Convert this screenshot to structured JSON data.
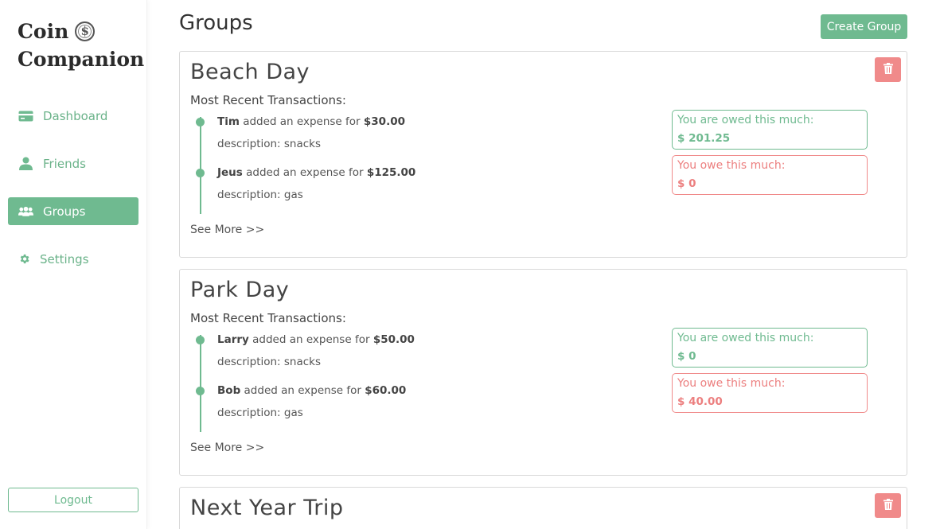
{
  "app": {
    "logo_line1": "Coin",
    "logo_line2": "Companion",
    "logo_icon": "dollar-coin-icon"
  },
  "sidebar": {
    "items": [
      {
        "label": "Dashboard",
        "icon": "card-icon",
        "active": false
      },
      {
        "label": "Friends",
        "icon": "user-icon",
        "active": false
      },
      {
        "label": "Groups",
        "icon": "users-icon",
        "active": true
      },
      {
        "label": "Settings",
        "icon": "gear-icon",
        "active": false
      }
    ],
    "logout_label": "Logout"
  },
  "header": {
    "title": "Groups",
    "create_button": "Create Group"
  },
  "colors": {
    "accent": "#6fba90",
    "danger": "#f08a8a"
  },
  "groups": [
    {
      "name": "Beach Day",
      "recent_label": "Most Recent Transactions:",
      "transactions": [
        {
          "user": "Tim",
          "text": "added an expense for",
          "amount": "$30.00",
          "description": "description: snacks"
        },
        {
          "user": "Jeus",
          "text": "added an expense for",
          "amount": "$125.00",
          "description": "description: gas"
        }
      ],
      "see_more": "See More >>",
      "owed_label": "You are owed this much:",
      "owed_value": "$ 201.25",
      "owe_label": "You owe this much:",
      "owe_value": "$ 0"
    },
    {
      "name": "Park Day",
      "recent_label": "Most Recent Transactions:",
      "transactions": [
        {
          "user": "Larry",
          "text": "added an expense for",
          "amount": "$50.00",
          "description": "description: snacks"
        },
        {
          "user": "Bob",
          "text": "added an expense for",
          "amount": "$60.00",
          "description": "description: gas"
        }
      ],
      "see_more": "See More >>",
      "owed_label": "You are owed this much:",
      "owed_value": "$ 0",
      "owe_label": "You owe this much:",
      "owe_value": "$ 40.00"
    },
    {
      "name": "Next Year Trip"
    }
  ]
}
